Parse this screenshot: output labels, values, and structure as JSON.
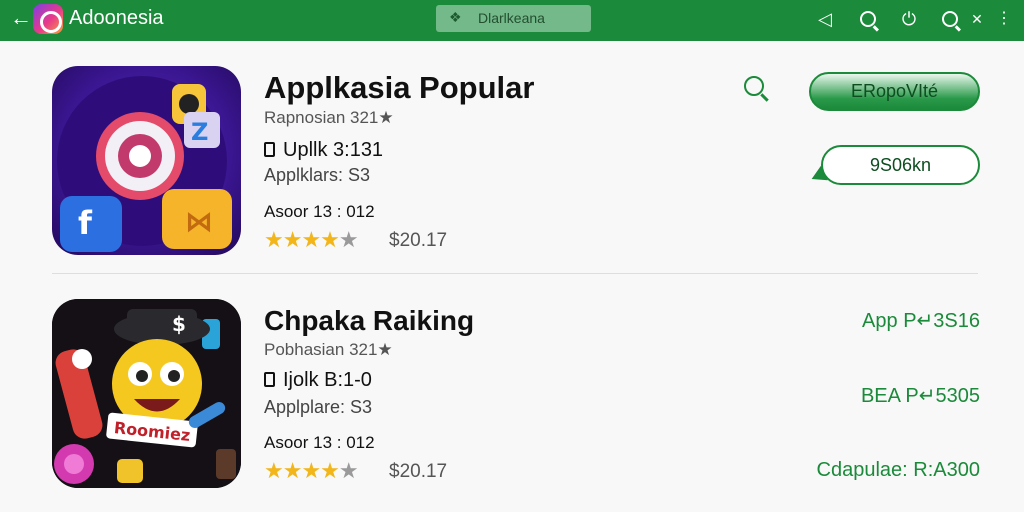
{
  "header": {
    "title": "Adoonesia",
    "search_text": "Dlarlkeana",
    "icons": [
      "back-icon",
      "app-logo-icon",
      "leaf-icon",
      "share-icon",
      "search-icon",
      "power-icon",
      "search-alt-icon",
      "more-icon"
    ]
  },
  "apps": [
    {
      "title": "Applkasia Popular",
      "subtitle": "Rapnosian 321★",
      "size": "Upllk 3:131",
      "category": "Applklars: S3",
      "meta": "Asoor 13 : 012",
      "stars": "★★★★",
      "star_dim": "★",
      "price": "$20.17",
      "primary_button": "ERopoVIté",
      "secondary_button": "9S06kn"
    },
    {
      "title": "Chpaka Raiking",
      "subtitle": "Pobhasian 321★",
      "size": "Ijolk B:1-0",
      "category": "Applplare: S3",
      "meta": "Asoor 13 : 012",
      "stars": "★★★★",
      "star_dim": "★",
      "price": "$20.17",
      "side_lines": [
        "App P↵3S16",
        "BEA P↵5305",
        "Cdapulae: R:A300"
      ]
    }
  ],
  "colors": {
    "brand_green": "#1b8a3a",
    "star": "#f2b51a"
  }
}
